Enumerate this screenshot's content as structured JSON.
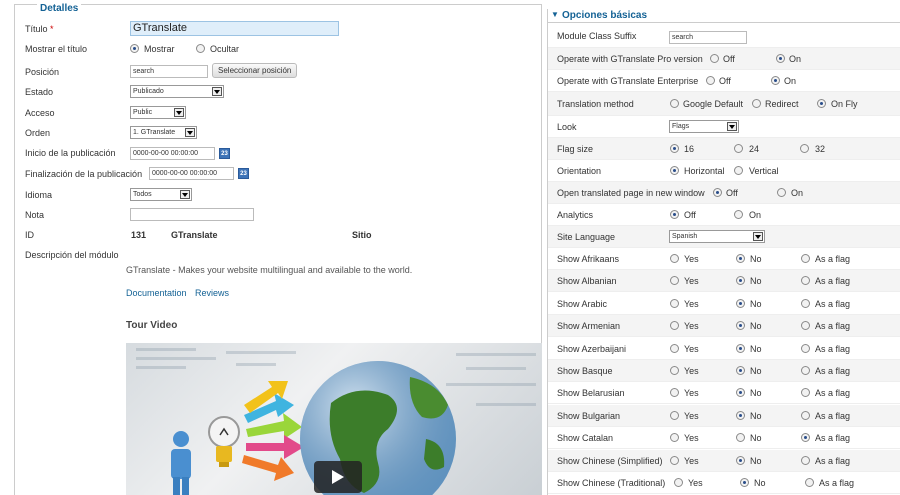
{
  "details": {
    "legend": "Detalles",
    "titulo_label": "Título",
    "titulo_req": "*",
    "titulo_value": "GTranslate",
    "mostrar_label": "Mostrar el título",
    "mostrar_opt": "Mostrar",
    "ocultar_opt": "Ocultar",
    "posicion_label": "Posición",
    "posicion_value": "search",
    "posicion_button": "Seleccionar posición",
    "estado_label": "Estado",
    "estado_value": "Publicado",
    "acceso_label": "Acceso",
    "acceso_value": "Public",
    "orden_label": "Orden",
    "orden_value": "1. GTranslate",
    "inicio_label": "Inicio de la publicación",
    "inicio_value": "0000-00-00 00:00:00",
    "fin_label": "Finalización de la publicación",
    "fin_value": "0000-00-00 00:00:00",
    "idioma_label": "Idioma",
    "idioma_value": "Todos",
    "nota_label": "Nota",
    "nota_value": "",
    "id_label": "ID",
    "id_value": "131",
    "id_name": "GTranslate",
    "id_site": "Sitio",
    "desc_label": "Descripción del módulo",
    "desc_text": "GTranslate - Makes your website multilingual and available to the world.",
    "doc_link": "Documentation",
    "reviews_link": "Reviews",
    "tour_title": "Tour Video",
    "cal_glyph": "23"
  },
  "options": {
    "header": "Opciones básicas",
    "suffix_label": "Module Class Suffix",
    "suffix_value": "search",
    "pro_label": "Operate with GTranslate Pro version",
    "ent_label": "Operate with GTranslate Enterprise",
    "off": "Off",
    "on": "On",
    "method_label": "Translation method",
    "method_google": "Google Default",
    "method_redirect": "Redirect",
    "method_onfly": "On Fly",
    "look_label": "Look",
    "look_value": "Flags",
    "flagsize_label": "Flag size",
    "fs16": "16",
    "fs24": "24",
    "fs32": "32",
    "orient_label": "Orientation",
    "horizontal": "Horizontal",
    "vertical": "Vertical",
    "newwin_label": "Open translated page in new window",
    "analytics_label": "Analytics",
    "sitelang_label": "Site Language",
    "sitelang_value": "Spanish",
    "yes": "Yes",
    "no": "No",
    "asflag": "As a flag",
    "langs": [
      "Show Afrikaans",
      "Show Albanian",
      "Show Arabic",
      "Show Armenian",
      "Show Azerbaijani",
      "Show Basque",
      "Show Belarusian",
      "Show Bulgarian",
      "Show Catalan",
      "Show Chinese (Simplified)",
      "Show Chinese (Traditional)"
    ]
  },
  "colors": {
    "accent": "#146295",
    "title_input_bg": "#dfeefa"
  }
}
